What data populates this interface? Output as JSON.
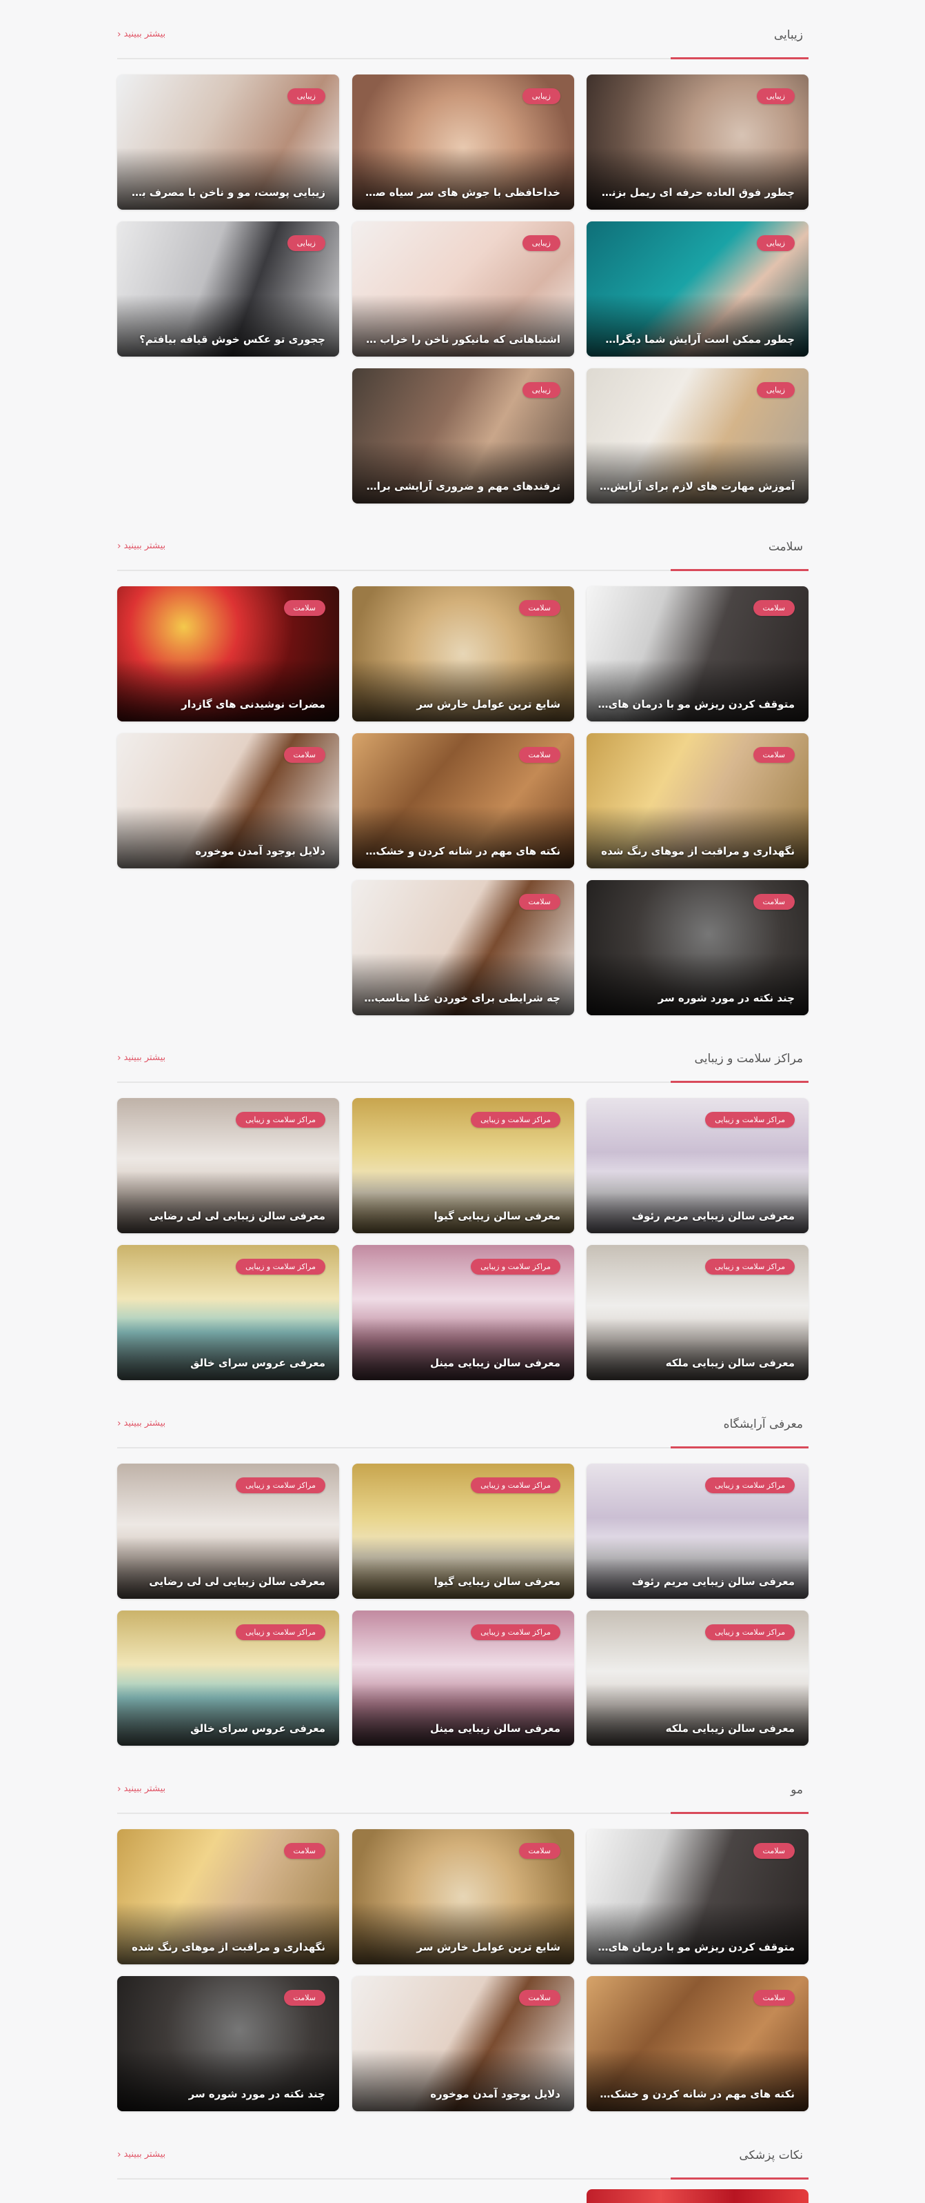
{
  "sections": [
    {
      "title": "زیبایی",
      "more": "بیشتر ببینید",
      "cards": [
        {
          "title": "چطور فوق العاده حرفه ای ریمل بزنیم؟",
          "badge": "زیبایی"
        },
        {
          "title": "خداحافظی با جوش های سر سیاه صورت",
          "badge": "زیبایی"
        },
        {
          "title": "زیبایی پوست، مو و ناخن با مصرف برخ...",
          "badge": "زیبایی"
        },
        {
          "title": "چطور ممکن است آرایش شما دیگران رو ...",
          "badge": "زیبایی"
        },
        {
          "title": "اشتباهاتی که مانیکور ناخن را خراب می ...",
          "badge": "زیبایی"
        },
        {
          "title": "چجوری تو عکس خوش قیافه بیافتم؟",
          "badge": "زیبایی"
        },
        {
          "title": "آموزش مهارت های لازم برای آرایش مو",
          "badge": "زیبایی"
        },
        {
          "title": "ترفندهای مهم و ضروری آرایشی برای خان...",
          "badge": "زیبایی"
        }
      ]
    },
    {
      "title": "سلامت",
      "more": "بیشتر ببینید",
      "cards": [
        {
          "title": "متوقف کردن ریزش مو با درمان های خان...",
          "badge": "سلامت"
        },
        {
          "title": "شایع ترین عوامل خارش سر",
          "badge": "سلامت"
        },
        {
          "title": "مضرات نوشیدنی های گازدار",
          "badge": "سلامت"
        },
        {
          "title": "نگهداری و مراقبت از موهای رنگ شده",
          "badge": "سلامت"
        },
        {
          "title": "نکته های مهم در شانه کردن و خشک کر...",
          "badge": "سلامت"
        },
        {
          "title": "دلایل بوجود آمدن موخوره",
          "badge": "سلامت"
        },
        {
          "title": "چند نکته در مورد شوره سر",
          "badge": "سلامت"
        },
        {
          "title": "چه شرایطی برای خوردن غذا مناسب نیس...",
          "badge": "سلامت"
        }
      ]
    },
    {
      "title": "مراکز سلامت و زیبایی",
      "more": "بیشتر ببینید",
      "cards": [
        {
          "title": "معرفی سالن زیبایی مریم رئوف",
          "badge": "مراکز سلامت و زیبایی"
        },
        {
          "title": "معرفی سالن زیبایی گیوا",
          "badge": "مراکز سلامت و زیبایی"
        },
        {
          "title": "معرفی سالن زیبایی لی لی رضایی",
          "badge": "مراکز سلامت و زیبایی"
        },
        {
          "title": "معرفی سالن زیبایی ملکه",
          "badge": "مراکز سلامت و زیبایی"
        },
        {
          "title": "معرفی سالن زیبایی مینل",
          "badge": "مراکز سلامت و زیبایی"
        },
        {
          "title": "معرفی عروس سرای خالق",
          "badge": "مراکز سلامت و زیبایی"
        }
      ]
    },
    {
      "title": "معرفی آرایشگاه",
      "more": "بیشتر ببینید",
      "cards": [
        {
          "title": "معرفی سالن زیبایی مریم رئوف",
          "badge": "مراکز سلامت و زیبایی"
        },
        {
          "title": "معرفی سالن زیبایی گیوا",
          "badge": "مراکز سلامت و زیبایی"
        },
        {
          "title": "معرفی سالن زیبایی لی لی رضایی",
          "badge": "مراکز سلامت و زیبایی"
        },
        {
          "title": "معرفی سالن زیبایی ملکه",
          "badge": "مراکز سلامت و زیبایی"
        },
        {
          "title": "معرفی سالن زیبایی مینل",
          "badge": "مراکز سلامت و زیبایی"
        },
        {
          "title": "معرفی عروس سرای خالق",
          "badge": "مراکز سلامت و زیبایی"
        }
      ]
    },
    {
      "title": "مو",
      "more": "بیشتر ببینید",
      "cards": [
        {
          "title": "متوقف کردن ریزش مو با درمان های خان...",
          "badge": "سلامت"
        },
        {
          "title": "شایع ترین عوامل خارش سر",
          "badge": "سلامت"
        },
        {
          "title": "نگهداری و مراقبت از موهای رنگ شده",
          "badge": "سلامت"
        },
        {
          "title": "نکته های مهم در شانه کردن و خشک کر...",
          "badge": "سلامت"
        },
        {
          "title": "دلایل بوجود آمدن موخوره",
          "badge": "سلامت"
        },
        {
          "title": "چند نکته در مورد شوره سر",
          "badge": "سلامت"
        }
      ]
    },
    {
      "title": "نکات پزشکی",
      "more": "بیشتر ببینید",
      "cards": []
    }
  ]
}
